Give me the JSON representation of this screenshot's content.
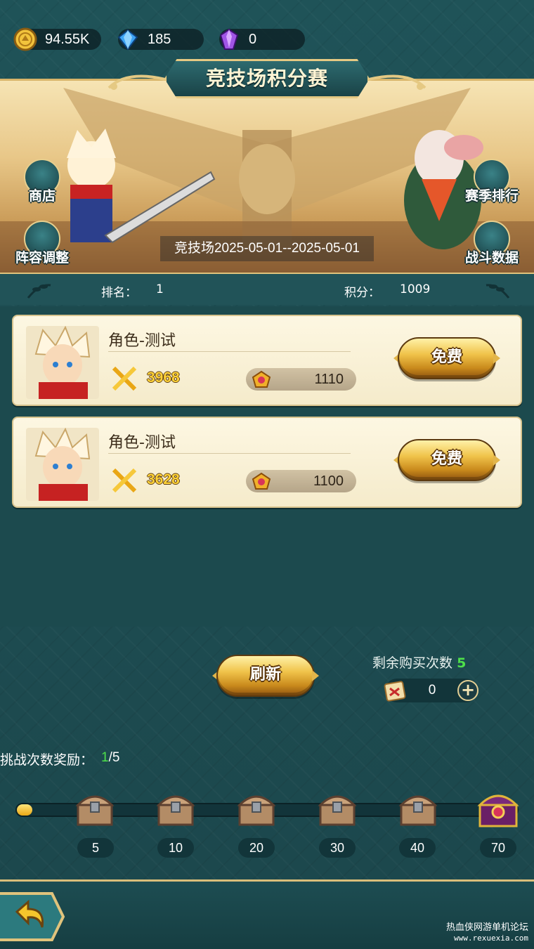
{
  "currency": [
    {
      "name": "gold",
      "icon": "gold-coin-icon",
      "value": "94.55K"
    },
    {
      "name": "diamond",
      "icon": "blue-diamond-icon",
      "value": "185"
    },
    {
      "name": "purple-gem",
      "icon": "purple-gem-icon",
      "value": "0"
    }
  ],
  "banner": {
    "title": "竞技场积分赛",
    "season_range": "竞技场2025-05-01--2025-05-01",
    "left_buttons": [
      {
        "label": "商店",
        "icon": "shop-icon"
      },
      {
        "label": "阵容调整",
        "icon": "team-icon"
      }
    ],
    "right_buttons": [
      {
        "label": "赛季排行",
        "icon": "trophy-icon"
      },
      {
        "label": "战斗数据",
        "icon": "stats-icon"
      }
    ]
  },
  "stats": {
    "rank_label": "排名：",
    "rank_value": "1",
    "points_label": "积分：",
    "points_value": "1009"
  },
  "opponents": [
    {
      "name": "角色-测试",
      "power": "3968",
      "score": "1110",
      "button": "免费"
    },
    {
      "name": "角色-测试",
      "power": "3628",
      "score": "1100",
      "button": "免费"
    }
  ],
  "refresh_label": "刷新",
  "purchase": {
    "label": "剩余购买次数",
    "count": "5",
    "tickets": "0",
    "plus": "+"
  },
  "rewards": {
    "label": "挑战次数奖励：",
    "current": "1",
    "total": "/5",
    "progress_fraction": 0.014,
    "milestones": [
      "5",
      "10",
      "20",
      "30",
      "40",
      "70"
    ]
  },
  "watermark": {
    "line1": "热血侠网游单机论坛",
    "line2": "www.rexuexia.com"
  },
  "colors": {
    "background": "#1e4e52",
    "gold_accent": "#e0c37c",
    "highlight_green": "#4ee04a",
    "power_yellow": "#ffd33a"
  }
}
